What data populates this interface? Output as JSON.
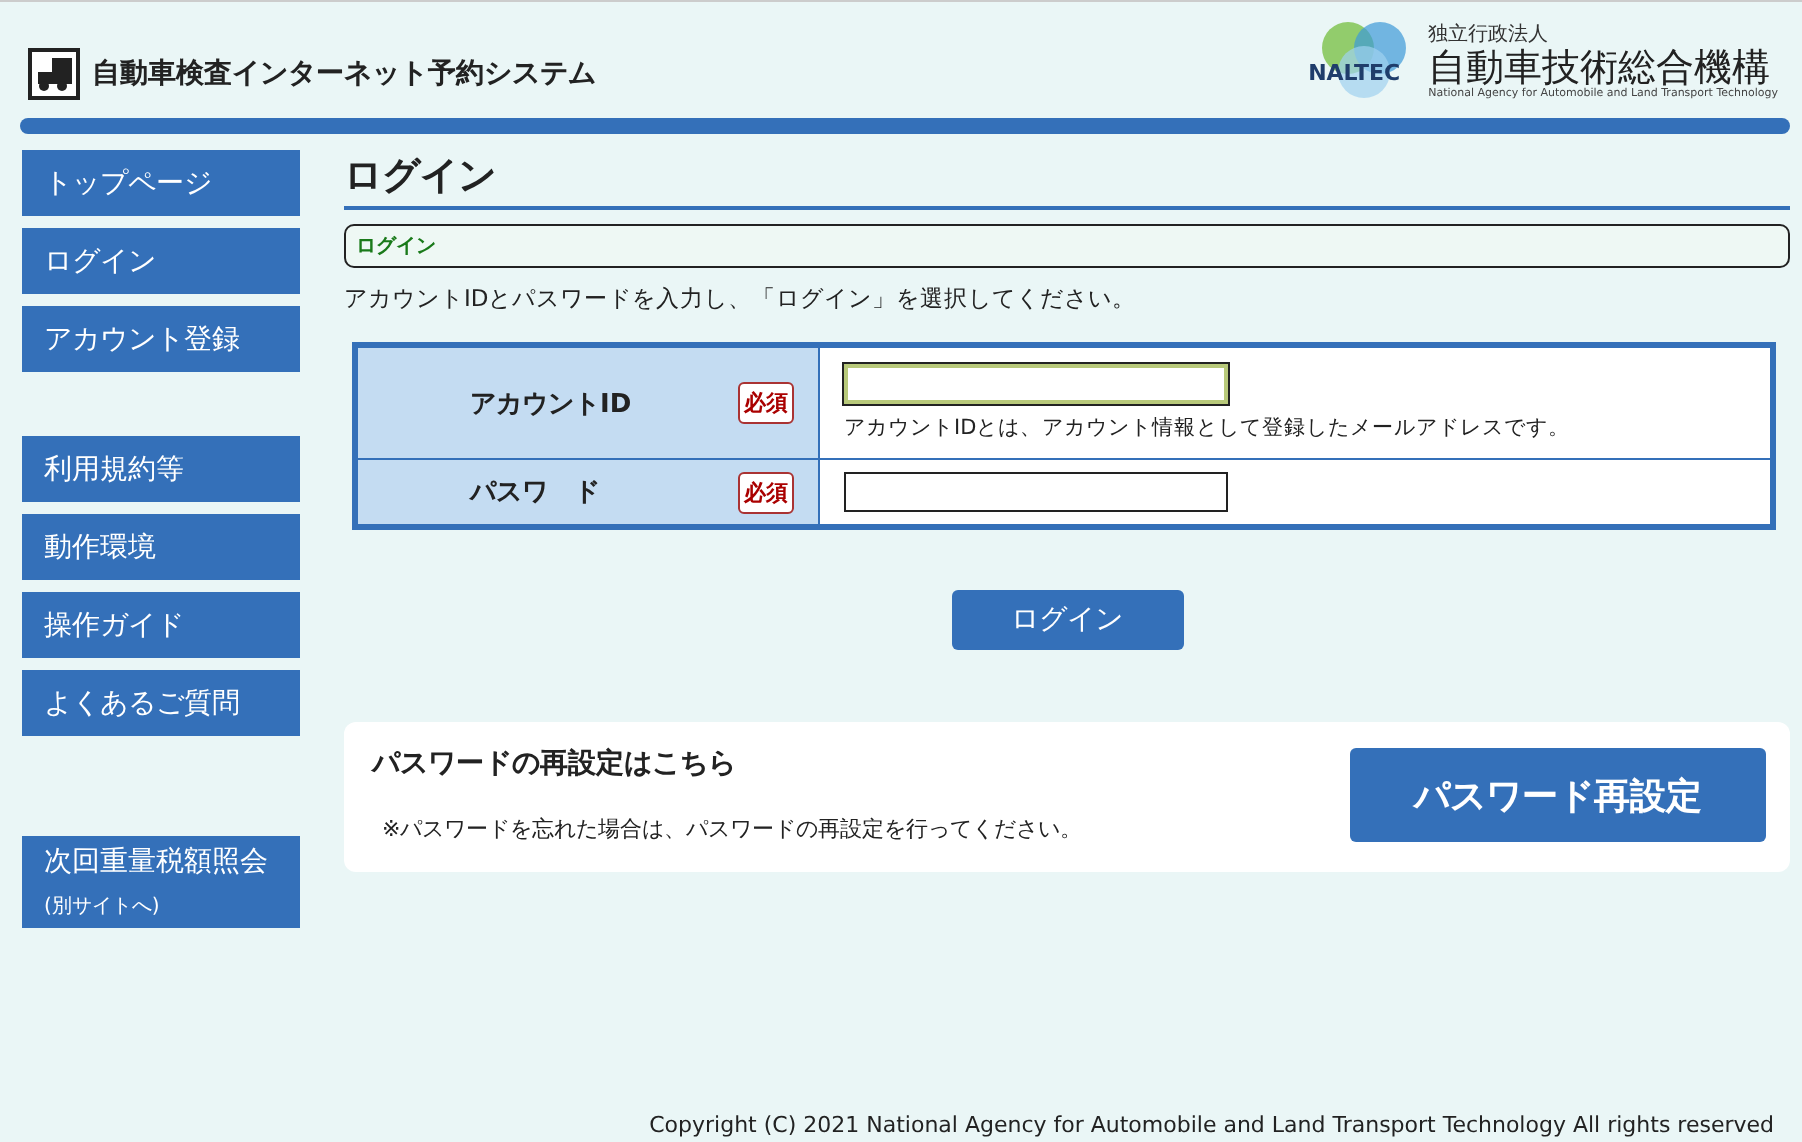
{
  "header": {
    "title": "自動車検査インターネット予約システム",
    "logo": {
      "mark": "NALTEC",
      "org_type": "独立行政法人",
      "org_name": "自動車技術総合機構",
      "org_name_en": "National Agency for Automobile and Land Transport Technology"
    }
  },
  "sidebar": {
    "groups": [
      {
        "items": [
          {
            "label": "トップページ"
          },
          {
            "label": "ログイン"
          },
          {
            "label": "アカウント登録"
          }
        ]
      },
      {
        "items": [
          {
            "label": "利用規約等"
          },
          {
            "label": "動作環境"
          },
          {
            "label": "操作ガイド"
          },
          {
            "label": "よくあるご質問"
          }
        ]
      },
      {
        "items": [
          {
            "label": "次回重量税額照会",
            "sublabel": "(別サイトへ)"
          }
        ]
      }
    ]
  },
  "page_title": "ログイン",
  "breadcrumb": "ログイン",
  "instruction": "アカウントIDとパスワードを入力し、「ログイン」を選択してください。",
  "form": {
    "rows": [
      {
        "label": "アカウントID",
        "required_badge": "必須",
        "focused": true,
        "hint": "アカウントIDとは、アカウント情報として登録したメールアドレスです。"
      },
      {
        "label": "パスワ　ド",
        "required_badge": "必須",
        "focused": false
      }
    ]
  },
  "login_button": "ログイン",
  "reset": {
    "heading": "パスワードの再設定はこちら",
    "note": "※パスワードを忘れた場合は、パスワードの再設定を行ってください。",
    "button": "パスワード再設定"
  },
  "footer": "Copyright (C) 2021 National Agency for Automobile and Land Transport Technology All rights reserved"
}
